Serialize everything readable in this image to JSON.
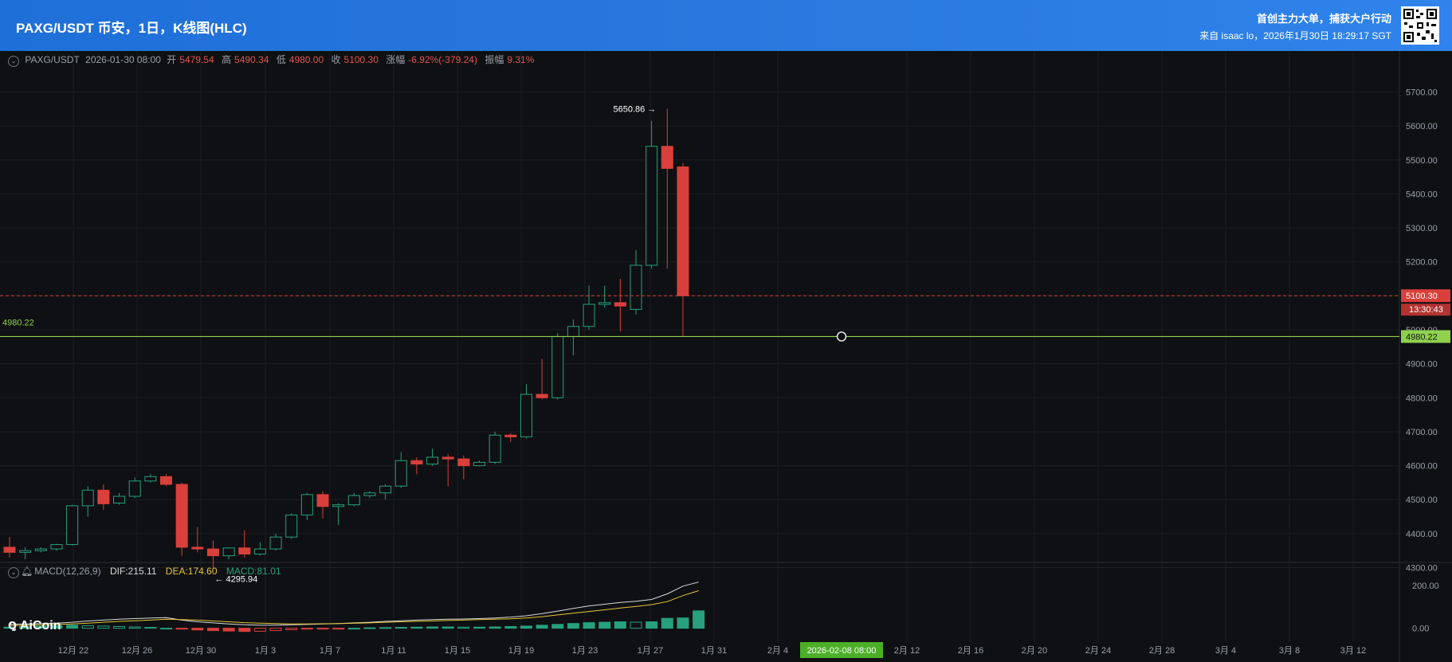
{
  "header": {
    "title": "PAXG/USDT 币安，1日，K线图(HLC)",
    "slogan": "首创主力大单，捕获大户行动",
    "source": "来自 isaac lo，2026年1月30日 18:29:17 SGT"
  },
  "info": {
    "symbol": "PAXG/USDT",
    "date": "2026-01-30 08:00",
    "open_label": "开",
    "open": "5479.54",
    "high_label": "高",
    "high": "5490.34",
    "low_label": "低",
    "low": "4980.00",
    "close_label": "收",
    "close": "5100.30",
    "change_label": "涨幅",
    "change": "-6.92%(-379.24)",
    "amp_label": "振幅",
    "amp": "9.31%"
  },
  "macd": {
    "name": "MACD(12,26,9)",
    "dif": "DIF:215.11",
    "dea": "DEA:174.60",
    "macd": "MACD:81.01",
    "colors": {
      "dif": "#d9d9d9",
      "dea": "#e8c53a",
      "macd": "#26a17b"
    }
  },
  "logo": "AiCoin",
  "markers": {
    "high": "5650.86",
    "low": "4295.94",
    "hline": "4980.22",
    "last_price": "5100.30",
    "countdown": "13:30:43",
    "hline_axis": "4980.22",
    "crosshair_date": "2026-02-08 08:00"
  },
  "colors": {
    "up": "#26a17b",
    "down": "#d9403c",
    "hline": "#8fd14f",
    "grid": "#1c1e23"
  },
  "chart_data": {
    "type": "candlestick",
    "x_ticks": [
      "12月 22",
      "12月 26",
      "12月 30",
      "1月 3",
      "1月 7",
      "1月 11",
      "1月 15",
      "1月 19",
      "1月 23",
      "1月 27",
      "1月 31",
      "2月 4",
      "2月 12",
      "2月 16",
      "2月 20",
      "2月 24",
      "2月 28",
      "3月 4",
      "3月 8",
      "3月 12"
    ],
    "y_ticks": [
      "5700.00",
      "5600.00",
      "5500.00",
      "5400.00",
      "5300.00",
      "5200.00",
      "5100.00",
      "5000.00",
      "4900.00",
      "4800.00",
      "4700.00",
      "4600.00",
      "4500.00",
      "4400.00",
      "4300.00"
    ],
    "ylim": [
      4245,
      5755
    ],
    "macd_ticks": [
      "200.00",
      "0.00"
    ],
    "candles": [
      {
        "date": "2025-12-19",
        "o": 4360,
        "h": 4390,
        "l": 4330,
        "c": 4345
      },
      {
        "date": "2025-12-20",
        "o": 4345,
        "h": 4360,
        "l": 4325,
        "c": 4350
      },
      {
        "date": "2025-12-21",
        "o": 4350,
        "h": 4360,
        "l": 4345,
        "c": 4355
      },
      {
        "date": "2025-12-22",
        "o": 4355,
        "h": 4370,
        "l": 4350,
        "c": 4368
      },
      {
        "date": "2025-12-23",
        "o": 4368,
        "h": 4485,
        "l": 4365,
        "c": 4482
      },
      {
        "date": "2025-12-24",
        "o": 4482,
        "h": 4540,
        "l": 4450,
        "c": 4528
      },
      {
        "date": "2025-12-25",
        "o": 4528,
        "h": 4545,
        "l": 4470,
        "c": 4488
      },
      {
        "date": "2025-12-26",
        "o": 4490,
        "h": 4520,
        "l": 4485,
        "c": 4510
      },
      {
        "date": "2025-12-27",
        "o": 4510,
        "h": 4565,
        "l": 4505,
        "c": 4555
      },
      {
        "date": "2025-12-28",
        "o": 4555,
        "h": 4575,
        "l": 4550,
        "c": 4568
      },
      {
        "date": "2025-12-29",
        "o": 4568,
        "h": 4575,
        "l": 4540,
        "c": 4545
      },
      {
        "date": "2025-12-30",
        "o": 4545,
        "h": 4550,
        "l": 4335,
        "c": 4360
      },
      {
        "date": "2025-12-31",
        "o": 4360,
        "h": 4420,
        "l": 4345,
        "c": 4355
      },
      {
        "date": "2026-01-01",
        "o": 4355,
        "h": 4380,
        "l": 4296,
        "c": 4335
      },
      {
        "date": "2026-01-02",
        "o": 4335,
        "h": 4360,
        "l": 4325,
        "c": 4358
      },
      {
        "date": "2026-01-03",
        "o": 4358,
        "h": 4410,
        "l": 4330,
        "c": 4340
      },
      {
        "date": "2026-01-04",
        "o": 4340,
        "h": 4375,
        "l": 4335,
        "c": 4355
      },
      {
        "date": "2026-01-05",
        "o": 4355,
        "h": 4400,
        "l": 4350,
        "c": 4390
      },
      {
        "date": "2026-01-06",
        "o": 4390,
        "h": 4460,
        "l": 4385,
        "c": 4455
      },
      {
        "date": "2026-01-07",
        "o": 4455,
        "h": 4520,
        "l": 4440,
        "c": 4515
      },
      {
        "date": "2026-01-08",
        "o": 4515,
        "h": 4525,
        "l": 4445,
        "c": 4480
      },
      {
        "date": "2026-01-09",
        "o": 4480,
        "h": 4490,
        "l": 4425,
        "c": 4485
      },
      {
        "date": "2026-01-10",
        "o": 4485,
        "h": 4520,
        "l": 4480,
        "c": 4512
      },
      {
        "date": "2026-01-11",
        "o": 4512,
        "h": 4525,
        "l": 4505,
        "c": 4520
      },
      {
        "date": "2026-01-12",
        "o": 4520,
        "h": 4545,
        "l": 4500,
        "c": 4540
      },
      {
        "date": "2026-01-13",
        "o": 4540,
        "h": 4640,
        "l": 4535,
        "c": 4615
      },
      {
        "date": "2026-01-14",
        "o": 4615,
        "h": 4625,
        "l": 4575,
        "c": 4605
      },
      {
        "date": "2026-01-15",
        "o": 4605,
        "h": 4650,
        "l": 4600,
        "c": 4625
      },
      {
        "date": "2026-01-16",
        "o": 4625,
        "h": 4635,
        "l": 4540,
        "c": 4620
      },
      {
        "date": "2026-01-17",
        "o": 4620,
        "h": 4630,
        "l": 4560,
        "c": 4600
      },
      {
        "date": "2026-01-18",
        "o": 4600,
        "h": 4615,
        "l": 4598,
        "c": 4610
      },
      {
        "date": "2026-01-19",
        "o": 4610,
        "h": 4700,
        "l": 4605,
        "c": 4690
      },
      {
        "date": "2026-01-20",
        "o": 4690,
        "h": 4695,
        "l": 4670,
        "c": 4685
      },
      {
        "date": "2026-01-21",
        "o": 4685,
        "h": 4840,
        "l": 4680,
        "c": 4810
      },
      {
        "date": "2026-01-22",
        "o": 4810,
        "h": 4915,
        "l": 4795,
        "c": 4800
      },
      {
        "date": "2026-01-23",
        "o": 4800,
        "h": 4990,
        "l": 4795,
        "c": 4980
      },
      {
        "date": "2026-01-24",
        "o": 4980,
        "h": 5030,
        "l": 4925,
        "c": 5010
      },
      {
        "date": "2026-01-25",
        "o": 5010,
        "h": 5130,
        "l": 5000,
        "c": 5075
      },
      {
        "date": "2026-01-26",
        "o": 5075,
        "h": 5130,
        "l": 5065,
        "c": 5080
      },
      {
        "date": "2026-01-27",
        "o": 5080,
        "h": 5150,
        "l": 4995,
        "c": 5070
      },
      {
        "date": "2026-01-28",
        "o": 5060,
        "h": 5235,
        "l": 5045,
        "c": 5190
      },
      {
        "date": "2026-01-29",
        "o": 5190,
        "h": 5615,
        "l": 5180,
        "c": 5540
      },
      {
        "date": "2026-01-30",
        "o": 5540,
        "h": 5651,
        "l": 5180,
        "c": 5475
      },
      {
        "date": "2026-01-31",
        "o": 5479.54,
        "h": 5490.34,
        "l": 4980,
        "c": 5100.3
      }
    ],
    "macd_hist": [
      5,
      8,
      10,
      12,
      14,
      12,
      10,
      8,
      6,
      4,
      0,
      -4,
      -8,
      -11,
      -13,
      -15,
      -14,
      -11,
      -7,
      -4,
      -2,
      -1,
      0,
      2,
      3,
      4,
      5,
      6,
      6,
      5,
      5,
      6,
      8,
      10,
      14,
      18,
      22,
      26,
      28,
      30,
      28,
      30,
      46,
      48,
      81
    ],
    "dif": [
      18,
      20,
      22,
      24,
      28,
      34,
      38,
      42,
      45,
      48,
      50,
      38,
      30,
      25,
      20,
      16,
      14,
      14,
      16,
      18,
      20,
      22,
      25,
      28,
      32,
      35,
      38,
      40,
      42,
      43,
      45,
      48,
      52,
      58,
      68,
      80,
      92,
      104,
      112,
      120,
      126,
      134,
      160,
      196,
      215
    ],
    "dea": [
      12,
      14,
      16,
      18,
      20,
      24,
      28,
      32,
      35,
      38,
      42,
      40,
      38,
      34,
      30,
      26,
      24,
      22,
      20,
      20,
      21,
      22,
      23,
      25,
      28,
      30,
      32,
      34,
      36,
      38,
      40,
      42,
      44,
      48,
      54,
      62,
      70,
      78,
      86,
      94,
      102,
      110,
      124,
      152,
      175
    ]
  }
}
